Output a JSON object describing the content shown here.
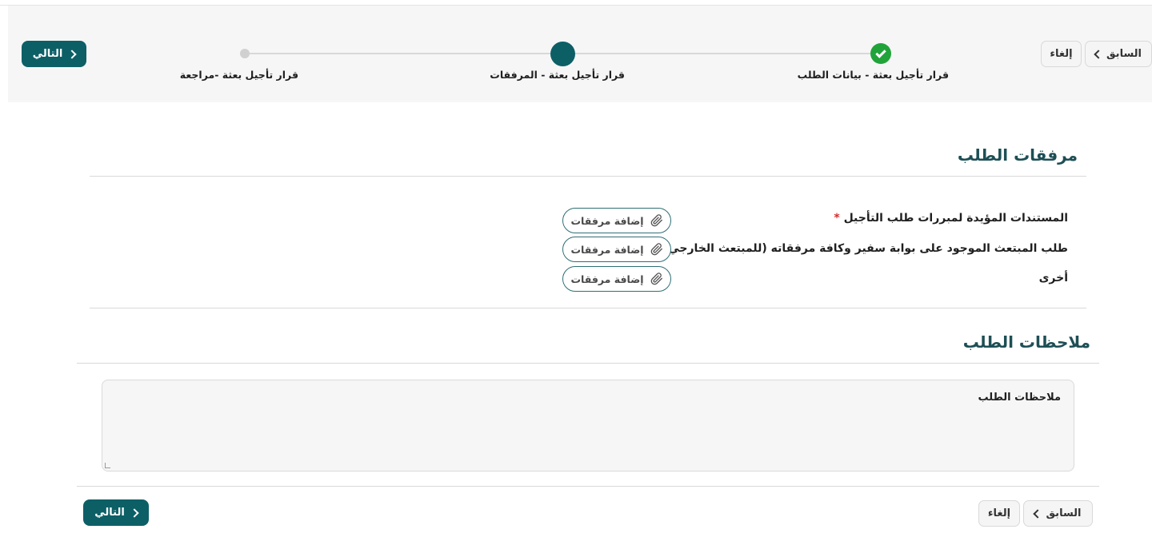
{
  "nav": {
    "prev_label": "السابق",
    "cancel_label": "إلغاء",
    "next_label": "التالي"
  },
  "stepper": {
    "steps": [
      {
        "label": "قرار تأجيل بعثة - بيانات الطلب",
        "status": "completed"
      },
      {
        "label": "قرار تأجيل بعثة - المرفقات",
        "status": "active"
      },
      {
        "label": "قرار تأجيل بعثة -مراجعة",
        "status": "pending"
      }
    ]
  },
  "attachments": {
    "title": "مرفقات الطلب",
    "required_mark": "*",
    "add_label": "إضافة مرفقات",
    "rows": [
      {
        "label": "المستندات المؤيدة لمبررات طلب التأجيل",
        "required": true
      },
      {
        "label": "طلب المبتعث الموجود على بوابة سفير وكافة مرفقاته (للمبتعث الخارجي)",
        "required": false
      },
      {
        "label": "أخرى",
        "required": false
      }
    ]
  },
  "notes": {
    "title": "ملاحظات الطلب",
    "placeholder": "ملاحظات الطلب"
  },
  "colors": {
    "primary": "#0d5f66",
    "success": "#21a33a",
    "heading": "#1d4f55",
    "required": "#d92b2b"
  },
  "icons": {
    "attach": "paperclip-icon",
    "prev": "chevron-left-icon",
    "next": "chevron-right-icon",
    "completed": "check-icon"
  }
}
